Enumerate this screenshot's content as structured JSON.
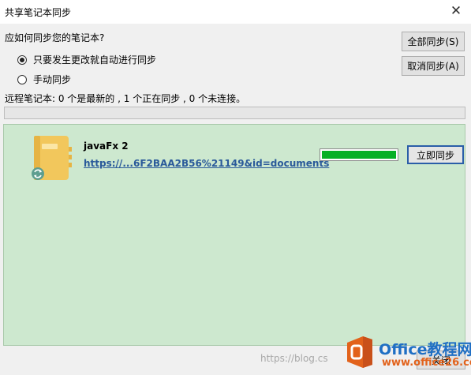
{
  "window": {
    "title": "共享笔记本同步",
    "close_glyph": "✕"
  },
  "question": "应如何同步您的笔记本?",
  "options": [
    {
      "label": "只要发生更改就自动进行同步",
      "checked": true
    },
    {
      "label": "手动同步",
      "checked": false
    }
  ],
  "buttons": {
    "sync_all": "全部同步(S)",
    "cancel_sync": "取消同步(A)",
    "sync_now": "立即同步",
    "close": "关闭"
  },
  "status_text": "远程笔记本: 0 个是最新的 , 1 个正在同步 , 0 个未连接。",
  "overall_progress": 0,
  "notebook": {
    "name": "javaFx 2",
    "link": "https://...6F2BAA2B56%21149&id=documents",
    "progress": 1.0,
    "icon": "notebook-sync-icon"
  },
  "watermark": "https://blog.cs",
  "logo": {
    "text": "Office教程网",
    "url": "www.office26.com"
  },
  "colors": {
    "panel_bg": "#cde8cf",
    "progress_fill": "#06b025",
    "link": "#2a5a9a",
    "logo_blue": "#1f6fc4",
    "logo_orange": "#e2621b"
  }
}
